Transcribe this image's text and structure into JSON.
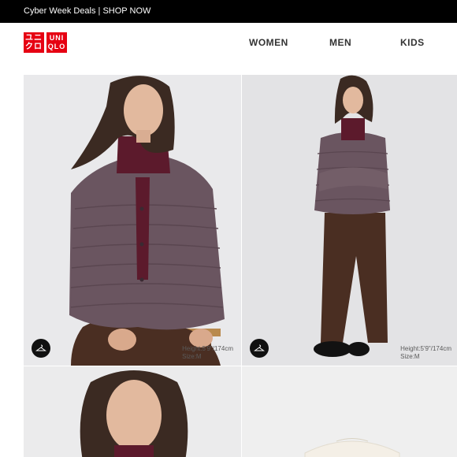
{
  "promo": {
    "text": "Cyber Week Deals | SHOP NOW"
  },
  "header": {
    "logo_top": "ユニ\nクロ",
    "logo_right": "UNI\nQLO",
    "nav": [
      "WOMEN",
      "MEN",
      "KIDS"
    ]
  },
  "products": [
    {
      "height": "Height:5'9\"/174cm",
      "size": "Size:M"
    },
    {
      "height": "Height:5'9\"/174cm",
      "size": "Size:M"
    }
  ],
  "colors": {
    "brand_red": "#e60012",
    "promo_bg": "#000000",
    "jacket": "#6a5560",
    "pants": "#4a2e22",
    "turtleneck": "#5c1a2c"
  }
}
